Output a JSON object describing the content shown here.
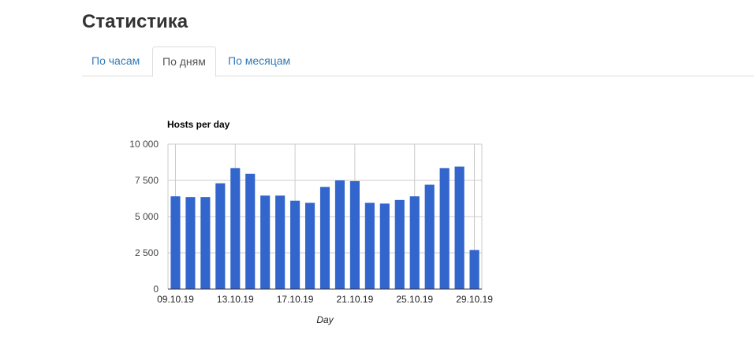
{
  "page": {
    "title": "Статистика"
  },
  "tabs": [
    {
      "label": "По часам",
      "active": false
    },
    {
      "label": "По дням",
      "active": true
    },
    {
      "label": "По месяцам",
      "active": false
    }
  ],
  "colors": {
    "bar": "#3366cc",
    "grid": "#cccccc",
    "tab_link": "#337ab7"
  },
  "chart_data": {
    "type": "bar",
    "title": "Hosts per day",
    "xlabel": "Day",
    "ylabel": "",
    "ylim": [
      0,
      10000
    ],
    "yticks": [
      0,
      2500,
      5000,
      7500,
      10000
    ],
    "ytick_labels": [
      "0",
      "2 500",
      "5 000",
      "7 500",
      "10 000"
    ],
    "grid": true,
    "legend": "none",
    "categories": [
      "09.10.19",
      "10.10.19",
      "11.10.19",
      "12.10.19",
      "13.10.19",
      "14.10.19",
      "15.10.19",
      "16.10.19",
      "17.10.19",
      "18.10.19",
      "19.10.19",
      "20.10.19",
      "21.10.19",
      "22.10.19",
      "23.10.19",
      "24.10.19",
      "25.10.19",
      "26.10.19",
      "27.10.19",
      "28.10.19",
      "29.10.19"
    ],
    "xtick_labels": [
      "09.10.19",
      "13.10.19",
      "17.10.19",
      "21.10.19",
      "25.10.19",
      "29.10.19"
    ],
    "values": [
      6400,
      6350,
      6350,
      7300,
      8350,
      7950,
      6450,
      6450,
      6100,
      5950,
      7050,
      7500,
      7450,
      5950,
      5900,
      6150,
      6400,
      7200,
      8350,
      8450,
      2700
    ]
  }
}
